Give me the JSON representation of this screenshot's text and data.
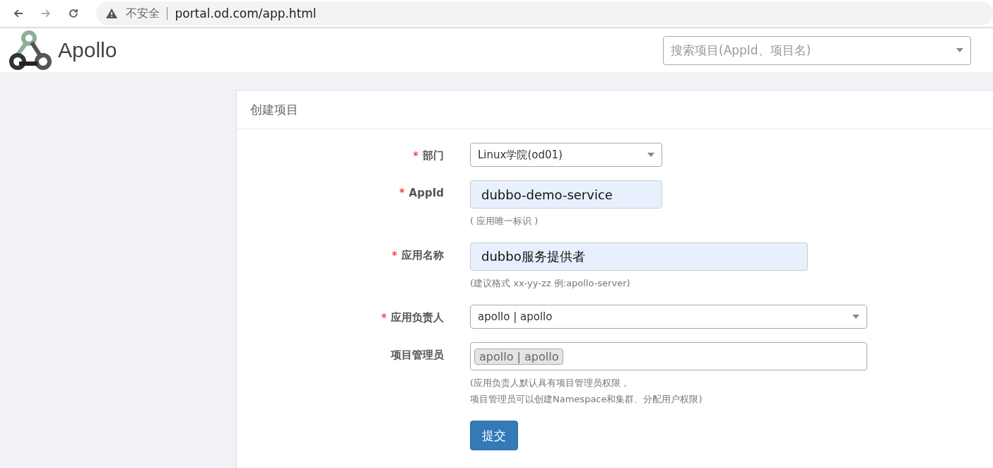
{
  "browser": {
    "security": "不安全",
    "url": "portal.od.com/app.html"
  },
  "header": {
    "logo": "Apollo",
    "search": {
      "placeholder": "搜索项目(AppId、项目名)"
    }
  },
  "panel": {
    "title": "创建项目",
    "fields": [
      {
        "kind": "select",
        "label": "部门",
        "required_mark": "*",
        "value": "Linux学院(od01)"
      },
      {
        "kind": "input",
        "label": "AppId",
        "required_mark": "*",
        "value": "dubbo-demo-service",
        "help": [
          "( 应用唯一标识 )"
        ]
      },
      {
        "kind": "input",
        "label": "应用名称",
        "required_mark": "*",
        "value": "dubbo服务提供者",
        "help": [
          "(建议格式 xx-yy-zz 例:apollo-server)"
        ]
      },
      {
        "kind": "select",
        "label": "应用负责人",
        "required_mark": "*",
        "value": "apollo | apollo"
      },
      {
        "kind": "tags",
        "label": "项目管理员",
        "tags": [
          "apollo | apollo"
        ],
        "help": [
          "(应用负责人默认具有项目管理员权限，",
          "项目管理员可以创建Namespace和集群、分配用户权限)"
        ]
      }
    ],
    "submit": "提交"
  }
}
